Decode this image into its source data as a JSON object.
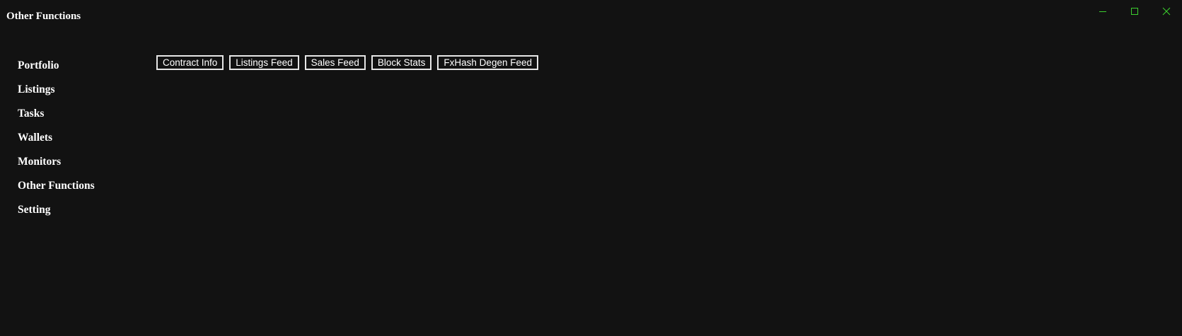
{
  "window": {
    "title": "Other Functions",
    "controls": {
      "minimize_icon": "minimize-icon",
      "maximize_icon": "maximize-icon",
      "close_icon": "close-icon",
      "accent_color": "#3ccf2e"
    }
  },
  "sidebar": {
    "items": [
      {
        "label": "Portfolio"
      },
      {
        "label": "Listings"
      },
      {
        "label": "Tasks"
      },
      {
        "label": "Wallets"
      },
      {
        "label": "Monitors"
      },
      {
        "label": "Other Functions"
      },
      {
        "label": "Setting"
      }
    ]
  },
  "toolbar": {
    "buttons": [
      {
        "label": "Contract Info"
      },
      {
        "label": "Listings Feed"
      },
      {
        "label": "Sales Feed"
      },
      {
        "label": "Block Stats"
      },
      {
        "label": "FxHash Degen Feed"
      }
    ]
  },
  "colors": {
    "background": "#121212",
    "text": "#ffffff",
    "button_border": "#e6e6e6"
  }
}
